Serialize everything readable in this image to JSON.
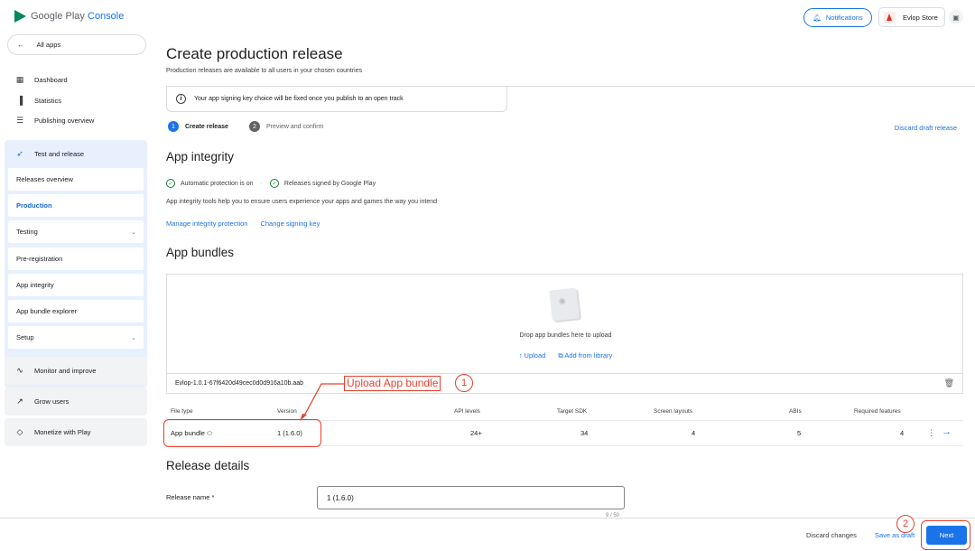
{
  "app": {
    "brand_main": "Google Play",
    "brand_sub": "Console"
  },
  "topbar": {
    "notifications": "Notifications",
    "store_name": "Evlop Store"
  },
  "sidebar": {
    "all_apps": "All apps",
    "items": [
      {
        "label": "Dashboard",
        "icon": "dashboard-icon"
      },
      {
        "label": "Statistics",
        "icon": "bar-chart-icon"
      },
      {
        "label": "Publishing overview",
        "icon": "publishing-icon"
      }
    ],
    "test_release": {
      "label": "Test and release",
      "sub": [
        {
          "label": "Releases overview"
        },
        {
          "label": "Production"
        },
        {
          "label": "Testing"
        },
        {
          "label": "Pre-registration"
        },
        {
          "label": "App integrity"
        },
        {
          "label": "App bundle explorer"
        },
        {
          "label": "Setup"
        }
      ]
    },
    "monitor": "Monitor and improve",
    "grow": "Grow users",
    "monetize": "Monetize with Play"
  },
  "main": {
    "title": "Create production release",
    "subtitle": "Production releases are available to all users in your chosen countries",
    "banner": "Your app signing key choice will be fixed once you publish to an open track",
    "steps": [
      {
        "num": "1",
        "label": "Create release"
      },
      {
        "num": "2",
        "label": "Preview and confirm"
      }
    ],
    "discard_draft": "Discard draft release",
    "integrity": {
      "heading": "App integrity",
      "check1": "Automatic protection is on",
      "check2": "Releases signed by Google Play",
      "text": "App integrity tools help you to ensure users experience your apps and games the way you intend",
      "link1": "Manage integrity protection",
      "link2": "Change signing key"
    },
    "bundles": {
      "heading": "App bundles",
      "drop_text": "Drop app bundles here to upload",
      "upload": "Upload",
      "add_library": "Add from library",
      "file_name": "Evlop-1.0.1-67f6420d49cec0d0d916a10b.aab",
      "columns": [
        "File type",
        "Version",
        "API levels",
        "Target SDK",
        "Screen layouts",
        "ABIs",
        "Required features"
      ],
      "row": {
        "file_type": "App bundle",
        "version": "1 (1.6.0)",
        "api_levels": "24+",
        "target_sdk": "34",
        "screen_layouts": "4",
        "abis": "5",
        "required_features": "4"
      }
    },
    "details": {
      "heading": "Release details",
      "name_label": "Release name *",
      "name_value": "1 (1.6.0)",
      "count": "9 / 50"
    }
  },
  "annotations": {
    "upload_label": "Upload App bundle",
    "num1": "1",
    "num2": "2",
    "color": "#e8412c"
  },
  "bottombar": {
    "discard": "Discard changes",
    "save_draft": "Save as draft",
    "next": "Next"
  },
  "colors": {
    "primary": "#1a73e8",
    "active_bg": "#e8f0fe",
    "success": "#188038"
  }
}
